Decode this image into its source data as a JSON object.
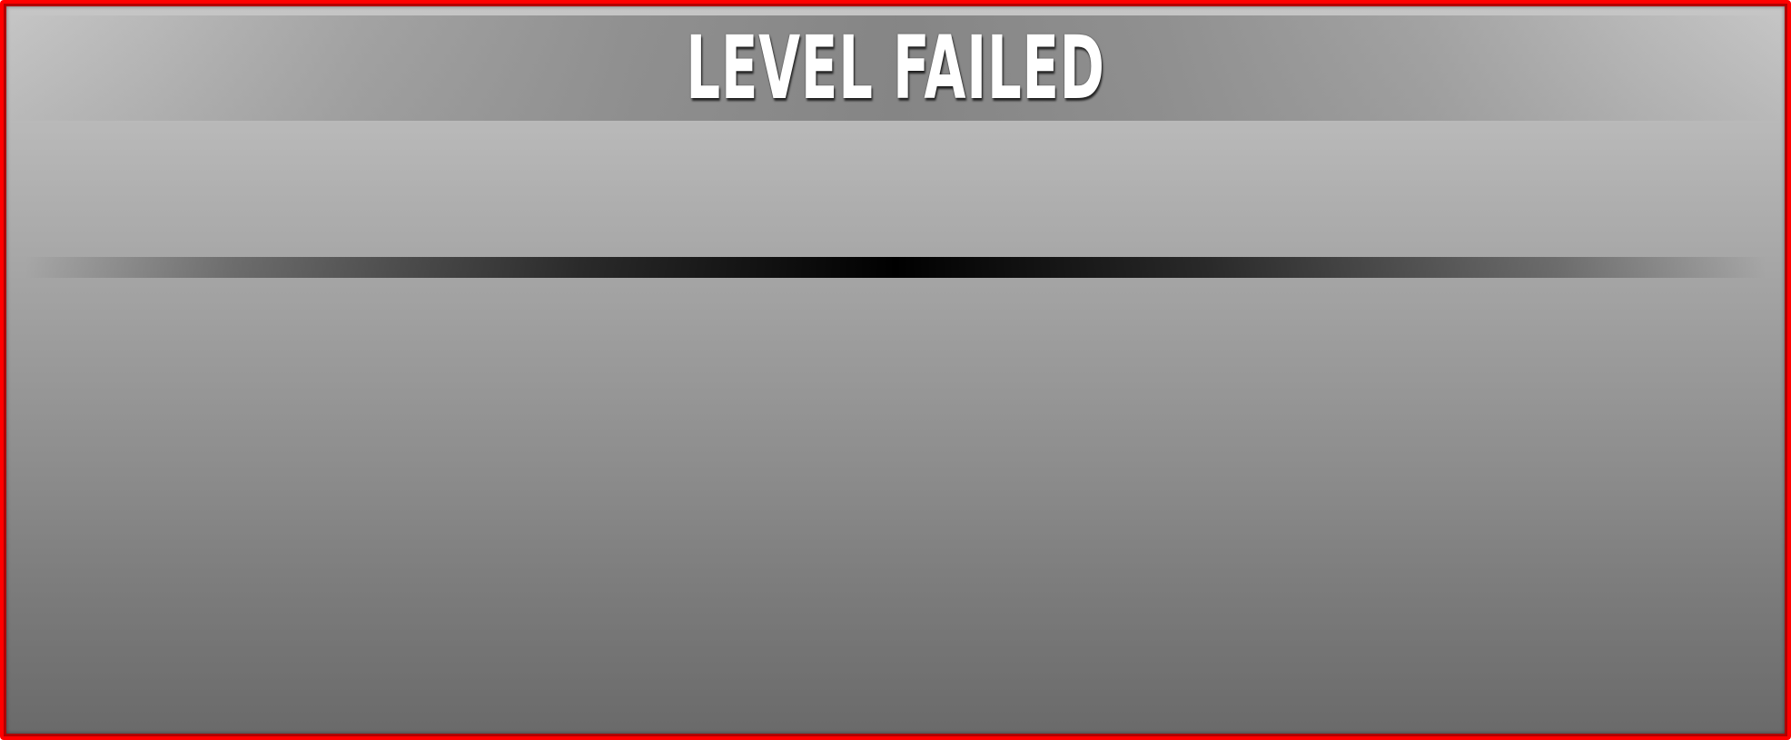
{
  "dialog": {
    "title": "LEVEL FAILED"
  },
  "colors": {
    "border": "#ff0000",
    "panel_top": "#c6c6c6",
    "panel_bottom": "#6a6a6a",
    "title_text": "#ffffff",
    "divider": "#000000"
  }
}
